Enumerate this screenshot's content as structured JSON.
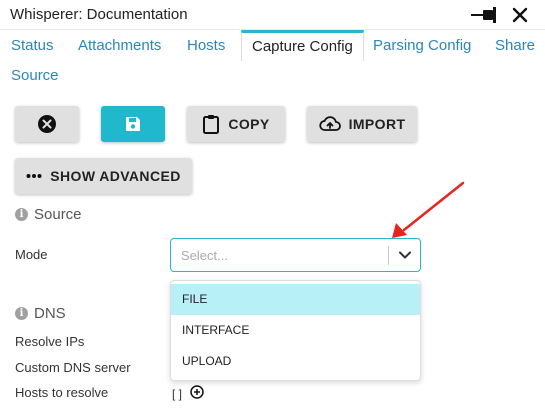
{
  "window": {
    "title": "Whisperer: Documentation",
    "pin_icon": "pin-icon",
    "close_icon": "close-icon"
  },
  "tabs": [
    {
      "label": "Status"
    },
    {
      "label": "Attachments"
    },
    {
      "label": "Hosts"
    },
    {
      "label": "Capture Config",
      "active": true
    },
    {
      "label": "Parsing Config"
    },
    {
      "label": "Share"
    },
    {
      "label": "Source"
    }
  ],
  "toolbar": {
    "discard_icon": "close-circle-icon",
    "save_icon": "floppy-disk-icon",
    "copy_label": "COPY",
    "import_label": "IMPORT",
    "advanced_label": "SHOW ADVANCED"
  },
  "source_section": {
    "title": "Source",
    "mode_label": "Mode",
    "mode_placeholder": "Select...",
    "options": [
      "FILE",
      "INTERFACE",
      "UPLOAD"
    ],
    "focused_option": "FILE"
  },
  "dns_section": {
    "title": "DNS",
    "resolve_ips_label": "Resolve IPs",
    "custom_dns_label": "Custom DNS server",
    "hosts_label": "Hosts to resolve",
    "hosts_value": "[ ]"
  },
  "colors": {
    "accent": "#1fb8cd",
    "tab_link": "#2b87b8",
    "option_highlight": "#b8f0f8",
    "annotation_arrow": "#e8241f"
  }
}
